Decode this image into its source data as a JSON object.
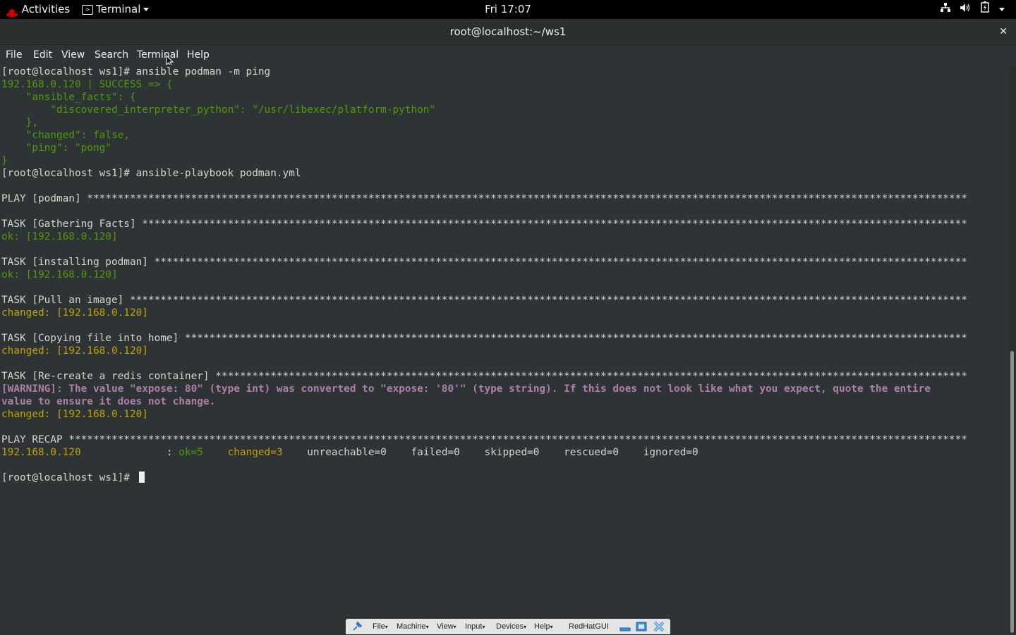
{
  "topbar": {
    "activities": "Activities",
    "app_menu": "Terminal",
    "clock": "Fri 17:07"
  },
  "window": {
    "title": "root@localhost:~/ws1",
    "close_glyph": "✕"
  },
  "menubar": {
    "items": [
      "File",
      "Edit",
      "View",
      "Search",
      "Terminal",
      "Help"
    ]
  },
  "terminal": {
    "lines": [
      {
        "segments": [
          {
            "text": "[root@localhost ws1]# ansible podman -m ping",
            "color": "w"
          }
        ]
      },
      {
        "segments": [
          {
            "text": "192.168.0.120 | SUCCESS => {",
            "color": "g"
          }
        ]
      },
      {
        "segments": [
          {
            "text": "    \"ansible_facts\": {",
            "color": "g"
          }
        ]
      },
      {
        "segments": [
          {
            "text": "        \"discovered_interpreter_python\": \"/usr/libexec/platform-python\"",
            "color": "g"
          }
        ]
      },
      {
        "segments": [
          {
            "text": "    },",
            "color": "g"
          }
        ]
      },
      {
        "segments": [
          {
            "text": "    \"changed\": false,",
            "color": "g"
          }
        ]
      },
      {
        "segments": [
          {
            "text": "    \"ping\": \"pong\"",
            "color": "g"
          }
        ]
      },
      {
        "segments": [
          {
            "text": "}",
            "color": "g"
          }
        ]
      },
      {
        "segments": [
          {
            "text": "[root@localhost ws1]# ansible-playbook podman.yml",
            "color": "w"
          }
        ]
      },
      {
        "segments": [
          {
            "text": "",
            "color": "w"
          }
        ]
      },
      {
        "segments": [
          {
            "text": "PLAY [podman] ************************************************************************************************************************************************",
            "color": "w"
          }
        ]
      },
      {
        "segments": [
          {
            "text": "",
            "color": "w"
          }
        ]
      },
      {
        "segments": [
          {
            "text": "TASK [Gathering Facts] ***************************************************************************************************************************************",
            "color": "w"
          }
        ]
      },
      {
        "segments": [
          {
            "text": "ok: [192.168.0.120]",
            "color": "g"
          }
        ]
      },
      {
        "segments": [
          {
            "text": "",
            "color": "w"
          }
        ]
      },
      {
        "segments": [
          {
            "text": "TASK [installing podman] *************************************************************************************************************************************",
            "color": "w"
          }
        ]
      },
      {
        "segments": [
          {
            "text": "ok: [192.168.0.120]",
            "color": "g"
          }
        ]
      },
      {
        "segments": [
          {
            "text": "",
            "color": "w"
          }
        ]
      },
      {
        "segments": [
          {
            "text": "TASK [Pull an image] *****************************************************************************************************************************************",
            "color": "w"
          }
        ]
      },
      {
        "segments": [
          {
            "text": "changed: [192.168.0.120]",
            "color": "y"
          }
        ]
      },
      {
        "segments": [
          {
            "text": "",
            "color": "w"
          }
        ]
      },
      {
        "segments": [
          {
            "text": "TASK [Copying file into home] ********************************************************************************************************************************",
            "color": "w"
          }
        ]
      },
      {
        "segments": [
          {
            "text": "changed: [192.168.0.120]",
            "color": "y"
          }
        ]
      },
      {
        "segments": [
          {
            "text": "",
            "color": "w"
          }
        ]
      },
      {
        "segments": [
          {
            "text": "TASK [Re-create a redis container] ***************************************************************************************************************************",
            "color": "w"
          }
        ]
      },
      {
        "segments": [
          {
            "text": "[WARNING]: The value \"expose: 80\" (type int) was converted to \"expose: '80'\" (type string). If this does not look like what you expect, quote the entire",
            "color": "m"
          }
        ]
      },
      {
        "segments": [
          {
            "text": "value to ensure it does not change.",
            "color": "m"
          }
        ]
      },
      {
        "segments": [
          {
            "text": "changed: [192.168.0.120]",
            "color": "y"
          }
        ]
      },
      {
        "segments": [
          {
            "text": "",
            "color": "w"
          }
        ]
      },
      {
        "segments": [
          {
            "text": "PLAY RECAP ***************************************************************************************************************************************************",
            "color": "w"
          }
        ]
      },
      {
        "segments": [
          {
            "text": "192.168.0.120",
            "color": "y"
          },
          {
            "text": "              : ",
            "color": "w"
          },
          {
            "text": "ok=5",
            "color": "g"
          },
          {
            "text": "    ",
            "color": "w"
          },
          {
            "text": "changed=3",
            "color": "y"
          },
          {
            "text": "    unreachable=0    failed=0    skipped=0    rescued=0    ignored=0",
            "color": "w"
          }
        ]
      },
      {
        "segments": [
          {
            "text": "",
            "color": "w"
          }
        ]
      },
      {
        "segments": [
          {
            "text": "[root@localhost ws1]# ",
            "color": "w"
          }
        ],
        "cursor": true
      }
    ]
  },
  "vbox": {
    "items": [
      "File",
      "Machine",
      "View",
      "Input",
      "Devices",
      "Help"
    ],
    "vm_name": "RedHatGUI"
  },
  "colors": {
    "terminal_bg": "#2e3436",
    "green": "#4e9a06",
    "yellow": "#c4a000",
    "magenta": "#ad7fa8",
    "default_fg": "#d3d7cf"
  }
}
